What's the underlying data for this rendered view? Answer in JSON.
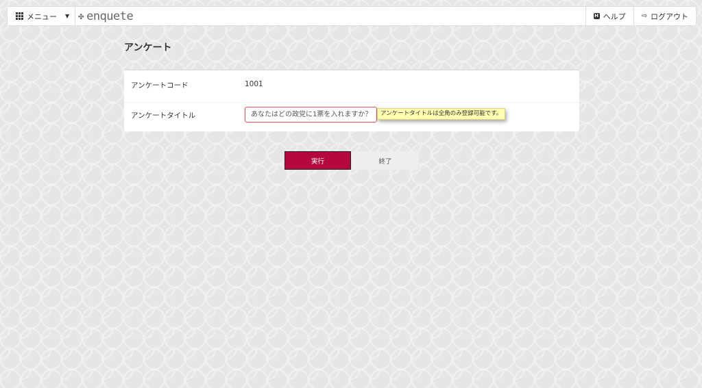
{
  "nav": {
    "menu_label": "メニュー",
    "brand": "enquete",
    "help_label": "ヘルプ",
    "logout_label": "ログアウト"
  },
  "page": {
    "title": "アンケート"
  },
  "form": {
    "code_label": "アンケートコード",
    "code_value": "1001",
    "title_label": "アンケートタイトル",
    "title_value": "あなたはどの政党に1票を入れますか？",
    "title_error": "アンケートタイトルは全角のみ登録可能です。"
  },
  "actions": {
    "execute_label": "実行",
    "end_label": "終了"
  },
  "colors": {
    "primary": "#b5093e",
    "error_border": "#e05555",
    "tooltip_bg": "#fffdb0"
  }
}
